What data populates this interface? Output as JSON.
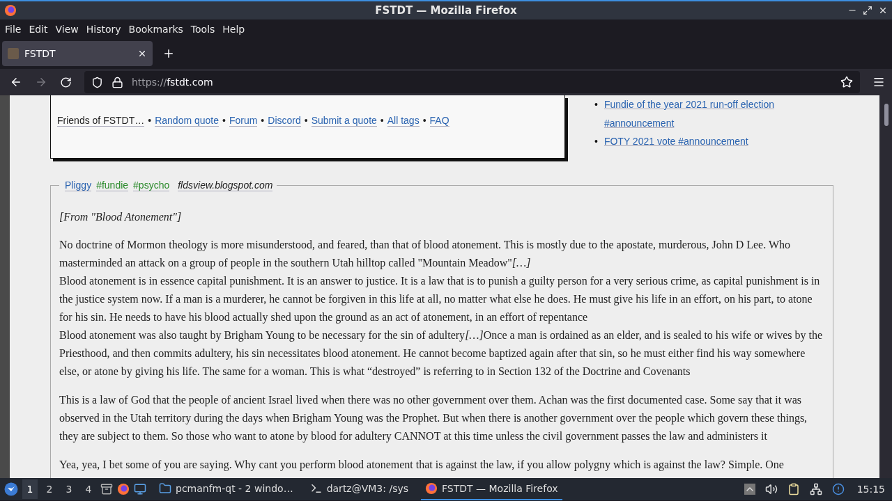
{
  "window": {
    "title": "FSTDT — Mozilla Firefox"
  },
  "menu": [
    "File",
    "Edit",
    "View",
    "History",
    "Bookmarks",
    "Tools",
    "Help"
  ],
  "tabs": [
    {
      "label": "FSTDT",
      "selected": true
    }
  ],
  "address": {
    "scheme": "https://",
    "host": "fstdt.com"
  },
  "header_links": [
    {
      "kind": "text",
      "label": "Friends of FSTDT…"
    },
    {
      "kind": "bullet",
      "label": "•"
    },
    {
      "kind": "link",
      "label": "Random quote"
    },
    {
      "kind": "bullet",
      "label": "•"
    },
    {
      "kind": "link",
      "label": "Forum"
    },
    {
      "kind": "bullet",
      "label": "•"
    },
    {
      "kind": "link",
      "label": "Discord"
    },
    {
      "kind": "bullet",
      "label": "•"
    },
    {
      "kind": "link",
      "label": "Submit a quote"
    },
    {
      "kind": "bullet",
      "label": "•"
    },
    {
      "kind": "link",
      "label": "All tags"
    },
    {
      "kind": "bullet",
      "label": "•"
    },
    {
      "kind": "link",
      "label": "FAQ"
    }
  ],
  "announcements": [
    {
      "bullet": "•",
      "label": "Fundie of the year 2021 run-off election #announcement"
    },
    {
      "bullet": "•",
      "label": "FOTY 2021 vote #announcement"
    }
  ],
  "quote": {
    "author": "Pliggy",
    "tags": [
      "#fundie",
      "#psycho"
    ],
    "source": "fldsview.blogspot.com",
    "paragraphs": [
      {
        "kind": "intro",
        "lines": [
          [
            {
              "text": "[From \"Blood Atonement\"]",
              "italic": true
            }
          ]
        ]
      },
      {
        "kind": "body",
        "lines": [
          [
            {
              "text": "No doctrine of Mormon theology is more misunderstood, and feared, than that of blood atonement. This is mostly due to the apostate, murderous, John D Lee. Who masterminded an attack on a group of people in the southern Utah hilltop called \"Mountain Meadow\"",
              "italic": false
            },
            {
              "text": "[…]",
              "italic": true
            }
          ],
          [
            {
              "text": "Blood atonement is in essence capital punishment. It is an answer to justice. It is a law that is to punish a guilty person for a very serious crime, as capital punishment is in the justice system now. If a man is a murderer, he cannot be forgiven in this life at all, no matter what else he does. He must give his life in an effort, on his part, to atone for his sin. He needs to have his blood actually shed upon the ground as an act of atonement, in an effort of repentance",
              "italic": false
            }
          ],
          [
            {
              "text": "Blood atonement was also taught by Brigham Young to be necessary for the sin of adultery",
              "italic": false
            },
            {
              "text": "[…]",
              "italic": true
            },
            {
              "text": "Once a man is ordained as an elder, and is sealed to his wife or wives by the Priesthood, and then commits adultery, his sin necessitates blood atonement. He cannot become baptized again after that sin, so he must either find his way somewhere else, or atone by giving his life. The same for a woman. This is what “destroyed” is referring to in Section 132 of the Doctrine and Covenants",
              "italic": false
            }
          ]
        ]
      },
      {
        "kind": "body",
        "lines": [
          [
            {
              "text": "This is a law of God that the people of ancient Israel lived when there was no other government over them. Achan was the first documented case. Some say that it was observed in the Utah territory during the days when Brigham Young was the Prophet. But when there is another government over the people which govern these things, they are subject to them. So those who want to atone by blood for adultery CANNOT at this time unless the civil government passes the law and administers it",
              "italic": false
            }
          ]
        ]
      },
      {
        "kind": "body",
        "lines": [
          [
            {
              "text": "Yea, yea, I bet some of you are saying. Why cant you perform blood atonement that is against the law, if you allow polygny which is against the law? Simple. One",
              "italic": false
            }
          ]
        ]
      }
    ]
  },
  "taskbar": {
    "workspaces": [
      {
        "label": "1",
        "selected": true
      },
      {
        "label": "2",
        "selected": false
      },
      {
        "label": "3",
        "selected": false
      },
      {
        "label": "4",
        "selected": false
      }
    ],
    "tasks": [
      {
        "kind": "folder",
        "label": "pcmanfm-qt - 2 windo…",
        "selected": false
      },
      {
        "kind": "terminal",
        "label": "dartz@VM3: /sys",
        "selected": false
      },
      {
        "kind": "browser",
        "label": "FSTDT — Mozilla Firefox",
        "selected": true
      }
    ],
    "clock": "15:15"
  }
}
